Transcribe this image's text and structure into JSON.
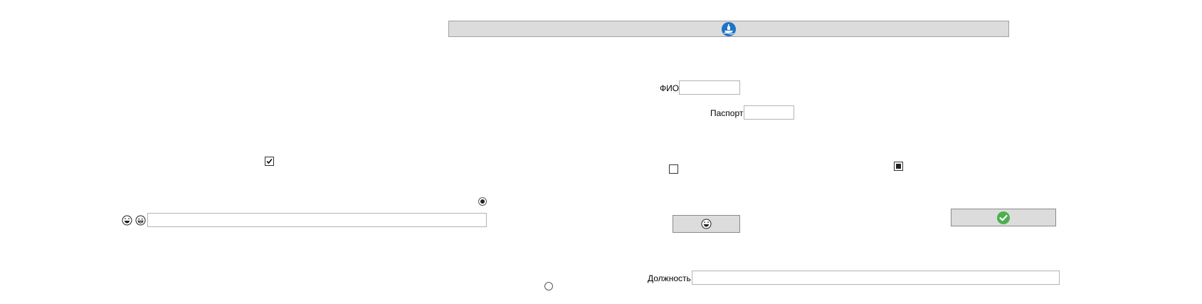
{
  "header": {
    "logo_icon": "ship-logo-icon",
    "accent_color": "#1e73c8"
  },
  "form": {
    "fio_label": "ФИО",
    "fio_value": "",
    "passport_label": "Паспорт",
    "passport_value": "",
    "position_label": "Должность",
    "position_value": ""
  },
  "left_panel": {
    "checkbox_checked": true,
    "radio_selected": true,
    "emoji_icons": [
      "laughing-face-icon",
      "grinning-face-icon"
    ],
    "text_value": ""
  },
  "controls": {
    "checkbox_unchecked": false,
    "checkbox_indeterminate": "indeterminate",
    "radio_unselected": false,
    "emoji_button_icon": "laughing-face-icon",
    "confirm_button_icon": "green-check-icon",
    "confirm_color": "#4caf50"
  }
}
